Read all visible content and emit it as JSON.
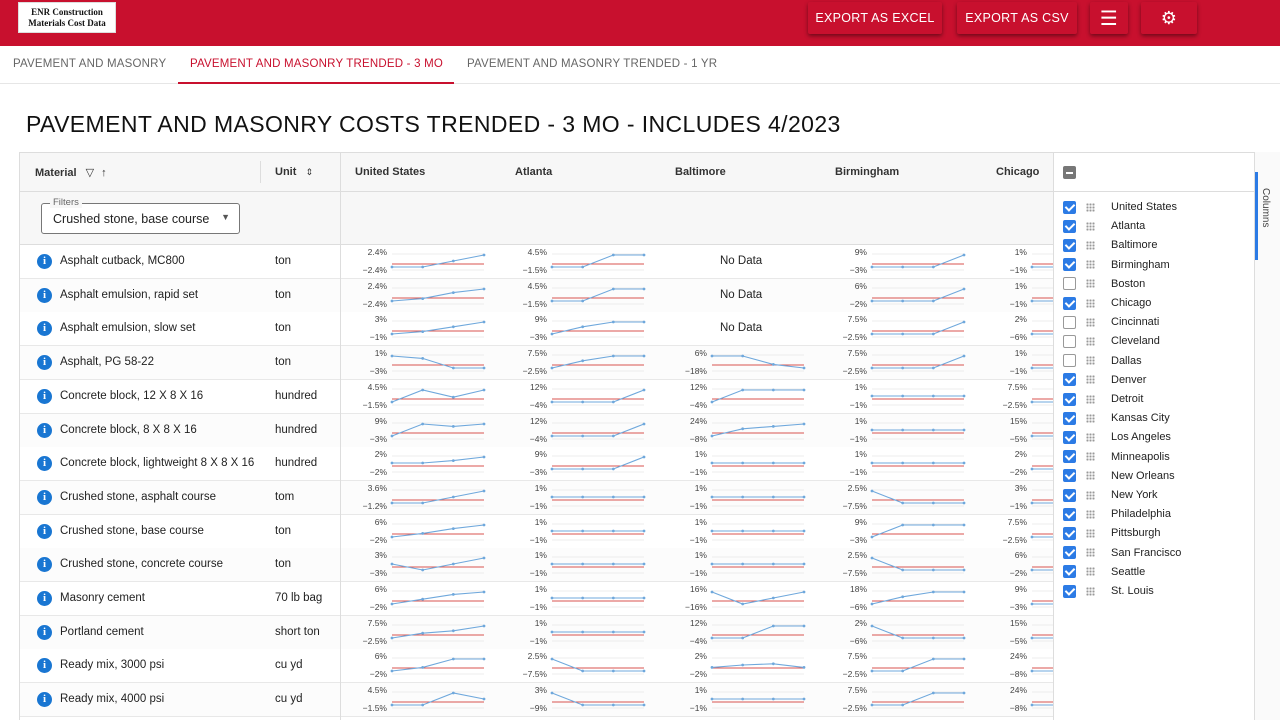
{
  "app": {
    "logo_line1": "ENR Construction",
    "logo_line2": "Materials Cost Data",
    "export_excel": "EXPORT AS EXCEL",
    "export_csv": "EXPORT AS CSV",
    "menu_icon": "☰",
    "gear_icon": "⚙"
  },
  "tabs": [
    {
      "label": "PAVEMENT AND MASONRY"
    },
    {
      "label": "PAVEMENT AND MASONRY TRENDED - 3 MO"
    },
    {
      "label": "PAVEMENT AND MASONRY TRENDED - 1 YR"
    }
  ],
  "page_title": "PAVEMENT AND MASONRY COSTS TRENDED - 3 MO - INCLUDES 4/2023",
  "grid": {
    "headers": {
      "material": "Material",
      "unit": "Unit",
      "cities": [
        "United States",
        "Atlanta",
        "Baltimore",
        "Birmingham",
        "Chicago"
      ]
    },
    "filter": {
      "label": "Filters",
      "value": "Crushed stone, base course"
    },
    "no_data": "No Data",
    "rows": [
      {
        "material": "Asphalt cutback, MC800",
        "unit": "ton",
        "cells": [
          {
            "hi": "2.4%",
            "lo": "−2.4%",
            "pts": [
              0,
              0,
              0.5,
              1
            ]
          },
          {
            "hi": "4.5%",
            "lo": "−1.5%",
            "pts": [
              0,
              0,
              1,
              1
            ]
          },
          null,
          {
            "hi": "9%",
            "lo": "−3%",
            "pts": [
              0,
              0,
              0,
              1
            ]
          },
          {
            "hi": "1%",
            "lo": "−1%",
            "pts": [
              0,
              0,
              0,
              0
            ]
          }
        ]
      },
      {
        "material": "Asphalt emulsion, rapid set",
        "unit": "ton",
        "cells": [
          {
            "hi": "2.4%",
            "lo": "−2.4%",
            "pts": [
              0,
              0.2,
              0.7,
              1
            ]
          },
          {
            "hi": "4.5%",
            "lo": "−1.5%",
            "pts": [
              0,
              0,
              1,
              1
            ]
          },
          null,
          {
            "hi": "6%",
            "lo": "−2%",
            "pts": [
              0,
              0,
              0,
              1
            ]
          },
          {
            "hi": "1%",
            "lo": "−1%",
            "pts": [
              0,
              0,
              0,
              0
            ]
          }
        ]
      },
      {
        "material": "Asphalt emulsion, slow set",
        "unit": "ton",
        "cells": [
          {
            "hi": "3%",
            "lo": "−1%",
            "pts": [
              0,
              0.2,
              0.6,
              1
            ]
          },
          {
            "hi": "9%",
            "lo": "−3%",
            "pts": [
              0,
              0.6,
              1,
              1
            ]
          },
          null,
          {
            "hi": "7.5%",
            "lo": "−2.5%",
            "pts": [
              0,
              0,
              0,
              1
            ]
          },
          {
            "hi": "2%",
            "lo": "−6%",
            "pts": [
              0,
              0,
              0,
              0
            ]
          }
        ]
      },
      {
        "material": "Asphalt, PG 58-22",
        "unit": "ton",
        "cells": [
          {
            "hi": "1%",
            "lo": "−3%",
            "pts": [
              1,
              0.8,
              0,
              0
            ]
          },
          {
            "hi": "7.5%",
            "lo": "−2.5%",
            "pts": [
              0,
              0.6,
              1,
              1
            ]
          },
          {
            "hi": "6%",
            "lo": "−18%",
            "pts": [
              1,
              1,
              0.3,
              0
            ]
          },
          {
            "hi": "7.5%",
            "lo": "−2.5%",
            "pts": [
              0,
              0,
              0,
              1
            ]
          },
          {
            "hi": "1%",
            "lo": "−1%",
            "pts": [
              0,
              0,
              0,
              0
            ]
          }
        ]
      },
      {
        "material": "Concrete block, 12 X 8 X 16",
        "unit": "hundred",
        "cells": [
          {
            "hi": "4.5%",
            "lo": "−1.5%",
            "pts": [
              0,
              1,
              0.4,
              1
            ]
          },
          {
            "hi": "12%",
            "lo": "−4%",
            "pts": [
              0,
              0,
              0,
              1
            ]
          },
          {
            "hi": "12%",
            "lo": "−4%",
            "pts": [
              0,
              1,
              1,
              1
            ]
          },
          {
            "hi": "1%",
            "lo": "−1%",
            "pts": [
              0.5,
              0.5,
              0.5,
              0.5
            ]
          },
          {
            "hi": "7.5%",
            "lo": "−2.5%",
            "pts": [
              0,
              0,
              0,
              0
            ]
          }
        ]
      },
      {
        "material": "Concrete block, 8 X 8 X 16",
        "unit": "hundred",
        "cells": [
          {
            "hi": "9%",
            "lo": "−3%",
            "pts": [
              0,
              1,
              0.8,
              1
            ]
          },
          {
            "hi": "12%",
            "lo": "−4%",
            "pts": [
              0,
              0,
              0,
              1
            ]
          },
          {
            "hi": "24%",
            "lo": "−8%",
            "pts": [
              0,
              0.6,
              0.8,
              1
            ]
          },
          {
            "hi": "1%",
            "lo": "−1%",
            "pts": [
              0.5,
              0.5,
              0.5,
              0.5
            ]
          },
          {
            "hi": "15%",
            "lo": "−5%",
            "pts": [
              0,
              0,
              0,
              0
            ]
          }
        ]
      },
      {
        "material": "Concrete block, lightweight 8 X 8 X 16",
        "unit": "hundred",
        "cells": [
          {
            "hi": "2%",
            "lo": "−2%",
            "pts": [
              0.5,
              0.5,
              0.7,
              1
            ]
          },
          {
            "hi": "9%",
            "lo": "−3%",
            "pts": [
              0,
              0,
              0,
              1
            ]
          },
          {
            "hi": "1%",
            "lo": "−1%",
            "pts": [
              0.5,
              0.5,
              0.5,
              0.5
            ]
          },
          {
            "hi": "1%",
            "lo": "−1%",
            "pts": [
              0.5,
              0.5,
              0.5,
              0.5
            ]
          },
          {
            "hi": "2%",
            "lo": "−2%",
            "pts": [
              0,
              0,
              0,
              0
            ]
          }
        ]
      },
      {
        "material": "Crushed stone, asphalt course",
        "unit": "tom",
        "cells": [
          {
            "hi": "3.6%",
            "lo": "−1.2%",
            "pts": [
              0,
              0,
              0.5,
              1
            ]
          },
          {
            "hi": "1%",
            "lo": "−1%",
            "pts": [
              0.5,
              0.5,
              0.5,
              0.5
            ]
          },
          {
            "hi": "1%",
            "lo": "−1%",
            "pts": [
              0.5,
              0.5,
              0.5,
              0.5
            ]
          },
          {
            "hi": "2.5%",
            "lo": "−7.5%",
            "pts": [
              1,
              0,
              0,
              0
            ]
          },
          {
            "hi": "3%",
            "lo": "−1%",
            "pts": [
              0,
              0,
              0,
              0
            ]
          }
        ]
      },
      {
        "material": "Crushed stone, base course",
        "unit": "ton",
        "cells": [
          {
            "hi": "6%",
            "lo": "−2%",
            "pts": [
              0,
              0.3,
              0.7,
              1
            ]
          },
          {
            "hi": "1%",
            "lo": "−1%",
            "pts": [
              0.5,
              0.5,
              0.5,
              0.5
            ]
          },
          {
            "hi": "1%",
            "lo": "−1%",
            "pts": [
              0.5,
              0.5,
              0.5,
              0.5
            ]
          },
          {
            "hi": "9%",
            "lo": "−3%",
            "pts": [
              0,
              1,
              1,
              1
            ]
          },
          {
            "hi": "7.5%",
            "lo": "−2.5%",
            "pts": [
              0,
              0,
              0,
              0
            ]
          }
        ]
      },
      {
        "material": "Crushed stone, concrete course",
        "unit": "ton",
        "cells": [
          {
            "hi": "3%",
            "lo": "−3%",
            "pts": [
              0.5,
              0,
              0.5,
              1
            ]
          },
          {
            "hi": "1%",
            "lo": "−1%",
            "pts": [
              0.5,
              0.5,
              0.5,
              0.5
            ]
          },
          {
            "hi": "1%",
            "lo": "−1%",
            "pts": [
              0.5,
              0.5,
              0.5,
              0.5
            ]
          },
          {
            "hi": "2.5%",
            "lo": "−7.5%",
            "pts": [
              1,
              0,
              0,
              0
            ]
          },
          {
            "hi": "6%",
            "lo": "−2%",
            "pts": [
              0,
              0,
              0,
              0
            ]
          }
        ]
      },
      {
        "material": "Masonry cement",
        "unit": "70 lb bag",
        "cells": [
          {
            "hi": "6%",
            "lo": "−2%",
            "pts": [
              0,
              0.4,
              0.8,
              1
            ]
          },
          {
            "hi": "1%",
            "lo": "−1%",
            "pts": [
              0.5,
              0.5,
              0.5,
              0.5
            ]
          },
          {
            "hi": "16%",
            "lo": "−16%",
            "pts": [
              1,
              0,
              0.5,
              1
            ]
          },
          {
            "hi": "18%",
            "lo": "−6%",
            "pts": [
              0,
              0.6,
              1,
              1
            ]
          },
          {
            "hi": "9%",
            "lo": "−3%",
            "pts": [
              0,
              0,
              0,
              0
            ]
          }
        ]
      },
      {
        "material": "Portland cement",
        "unit": "short ton",
        "cells": [
          {
            "hi": "7.5%",
            "lo": "−2.5%",
            "pts": [
              0,
              0.4,
              0.6,
              1
            ]
          },
          {
            "hi": "1%",
            "lo": "−1%",
            "pts": [
              0.5,
              0.5,
              0.5,
              0.5
            ]
          },
          {
            "hi": "12%",
            "lo": "−4%",
            "pts": [
              0,
              0,
              1,
              1
            ]
          },
          {
            "hi": "2%",
            "lo": "−6%",
            "pts": [
              1,
              0,
              0,
              0
            ]
          },
          {
            "hi": "15%",
            "lo": "−5%",
            "pts": [
              0,
              0,
              0,
              0
            ]
          }
        ]
      },
      {
        "material": "Ready mix, 3000 psi",
        "unit": "cu yd",
        "cells": [
          {
            "hi": "6%",
            "lo": "−2%",
            "pts": [
              0,
              0.3,
              1,
              1
            ]
          },
          {
            "hi": "2.5%",
            "lo": "−7.5%",
            "pts": [
              1,
              0,
              0,
              0
            ]
          },
          {
            "hi": "2%",
            "lo": "−2%",
            "pts": [
              0.3,
              0.5,
              0.6,
              0.3
            ]
          },
          {
            "hi": "7.5%",
            "lo": "−2.5%",
            "pts": [
              0,
              0,
              1,
              1
            ]
          },
          {
            "hi": "24%",
            "lo": "−8%",
            "pts": [
              0,
              0,
              0,
              0
            ]
          }
        ]
      },
      {
        "material": "Ready mix, 4000 psi",
        "unit": "cu yd",
        "cells": [
          {
            "hi": "4.5%",
            "lo": "−1.5%",
            "pts": [
              0,
              0,
              1,
              0.5
            ]
          },
          {
            "hi": "3%",
            "lo": "−9%",
            "pts": [
              1,
              0,
              0,
              0
            ]
          },
          {
            "hi": "1%",
            "lo": "−1%",
            "pts": [
              0.5,
              0.5,
              0.5,
              0.5
            ]
          },
          {
            "hi": "7.5%",
            "lo": "−2.5%",
            "pts": [
              0,
              0,
              1,
              1
            ]
          },
          {
            "hi": "24%",
            "lo": "−8%",
            "pts": [
              0,
              0,
              0,
              0
            ]
          }
        ]
      }
    ]
  },
  "side_panel": {
    "tab_label": "Columns",
    "columns": [
      {
        "label": "United States",
        "checked": true
      },
      {
        "label": "Atlanta",
        "checked": true
      },
      {
        "label": "Baltimore",
        "checked": true
      },
      {
        "label": "Birmingham",
        "checked": true
      },
      {
        "label": "Boston",
        "checked": false
      },
      {
        "label": "Chicago",
        "checked": true
      },
      {
        "label": "Cincinnati",
        "checked": false
      },
      {
        "label": "Cleveland",
        "checked": false
      },
      {
        "label": "Dallas",
        "checked": false
      },
      {
        "label": "Denver",
        "checked": true
      },
      {
        "label": "Detroit",
        "checked": true
      },
      {
        "label": "Kansas City",
        "checked": true
      },
      {
        "label": "Los Angeles",
        "checked": true
      },
      {
        "label": "Minneapolis",
        "checked": true
      },
      {
        "label": "New Orleans",
        "checked": true
      },
      {
        "label": "New York",
        "checked": true
      },
      {
        "label": "Philadelphia",
        "checked": true
      },
      {
        "label": "Pittsburgh",
        "checked": true
      },
      {
        "label": "San Francisco",
        "checked": true
      },
      {
        "label": "Seattle",
        "checked": true
      },
      {
        "label": "St. Louis",
        "checked": true
      }
    ]
  },
  "colors": {
    "brand": "#c8102e",
    "accent": "#2c7be5",
    "spark_line": "#6fa8dc",
    "spark_ref": "#d9534f"
  }
}
